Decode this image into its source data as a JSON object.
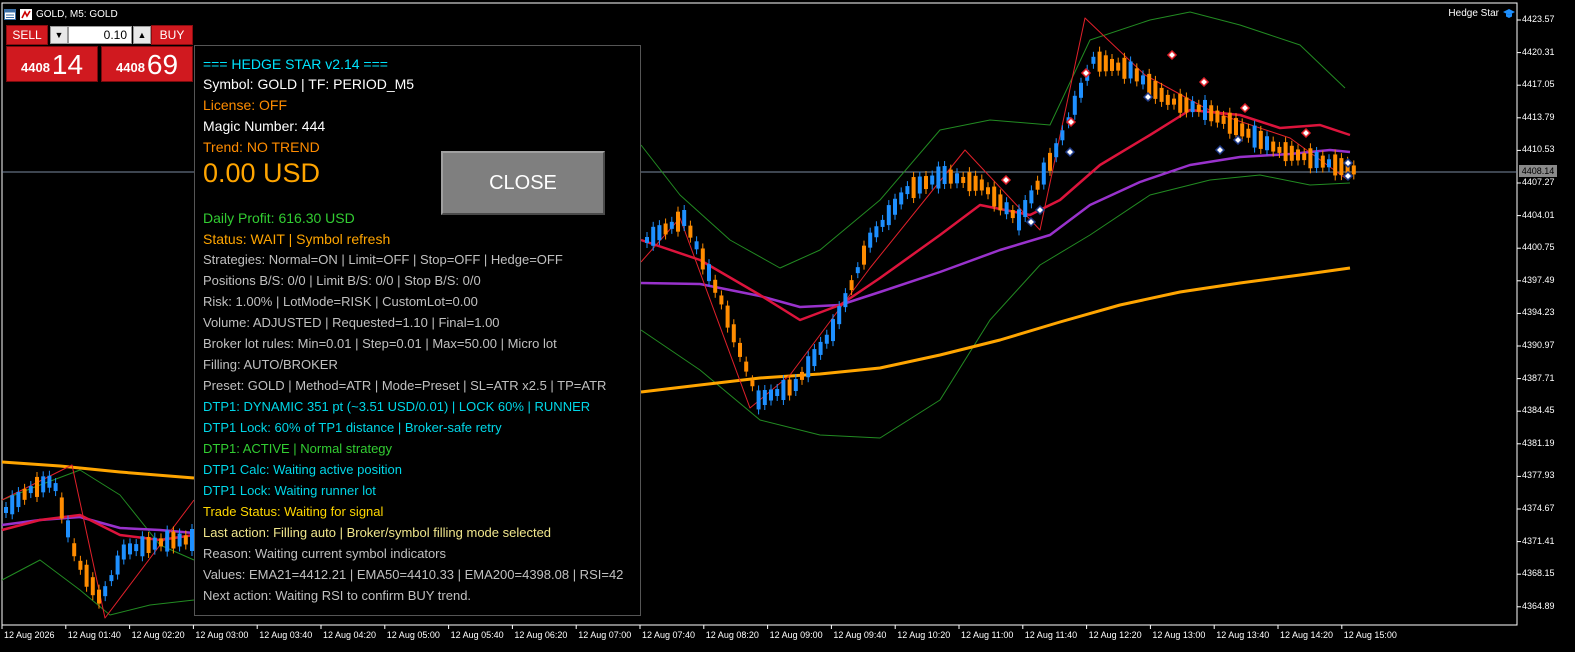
{
  "window": {
    "title": "GOLD, M5:  GOLD",
    "brand": "Hedge Star"
  },
  "trade_panel": {
    "sell_label": "SELL",
    "buy_label": "BUY",
    "lot": "0.10",
    "sell_price_prefix": "4408",
    "sell_price_big": "14",
    "buy_price_prefix": "4408",
    "buy_price_big": "69"
  },
  "info": {
    "lines": [
      {
        "text": "=== HEDGE STAR v2.14 ===",
        "color": "#00e5ff"
      },
      {
        "text": "Symbol: GOLD | TF: PERIOD_M5",
        "color": "#ffffff"
      },
      {
        "text": "License: OFF",
        "color": "#ff8c00"
      },
      {
        "text": "Magic Number: 444",
        "color": "#ffffff"
      },
      {
        "text": "Trend: NO TREND",
        "color": "#ff8c00"
      },
      {
        "text": "0.00 USD",
        "color": "#ffa500"
      },
      {
        "text": "Daily Profit: 616.30 USD",
        "color": "#32cd32"
      },
      {
        "text": "Status: WAIT | Symbol refresh",
        "color": "#ffa500"
      },
      {
        "text": "Strategies: Normal=ON | Limit=OFF | Stop=OFF | Hedge=OFF",
        "color": "#c0c0c0"
      },
      {
        "text": "Positions B/S: 0/0 | Limit B/S: 0/0 | Stop B/S: 0/0",
        "color": "#c0c0c0"
      },
      {
        "text": "Risk: 1.00% | LotMode=RISK | CustomLot=0.00",
        "color": "#c0c0c0"
      },
      {
        "text": "Volume: ADJUSTED | Requested=1.10 | Final=1.00",
        "color": "#c0c0c0"
      },
      {
        "text": "Broker lot rules: Min=0.01 | Step=0.01 | Max=50.00 | Micro lot",
        "color": "#c0c0c0"
      },
      {
        "text": "Filling: AUTO/BROKER",
        "color": "#c0c0c0"
      },
      {
        "text": "Preset: GOLD | Method=ATR | Mode=Preset | SL=ATR x2.5 | TP=ATR",
        "color": "#c0c0c0"
      },
      {
        "text": "DTP1: DYNAMIC 351 pt (~3.51 USD/0.01) | LOCK 60% | RUNNER",
        "color": "#00d7e8"
      },
      {
        "text": "DTP1 Lock: 60% of TP1 distance | Broker-safe retry",
        "color": "#00d7e8"
      },
      {
        "text": "DTP1: ACTIVE | Normal strategy",
        "color": "#32cd32"
      },
      {
        "text": "DTP1 Calc: Waiting active position",
        "color": "#00d7e8"
      },
      {
        "text": "DTP1 Lock: Waiting runner lot",
        "color": "#00d7e8"
      },
      {
        "text": "Trade Status: Waiting for signal",
        "color": "#ffd700"
      },
      {
        "text": "Last action: Filling auto | Broker/symbol filling mode selected",
        "color": "#f0e68c"
      },
      {
        "text": "Reason: Waiting current symbol indicators",
        "color": "#c0c0c0"
      },
      {
        "text": "Values: EMA21=4412.21 | EMA50=4410.33 | EMA200=4398.08 | RSI=42",
        "color": "#c0c0c0"
      },
      {
        "text": "Next action: Waiting RSI to confirm BUY trend.",
        "color": "#c0c0c0"
      }
    ],
    "close_label": "CLOSE"
  },
  "price_axis": {
    "ticks": [
      "4423.57",
      "4420.31",
      "4417.05",
      "4413.79",
      "4410.53",
      "4407.27",
      "4404.01",
      "4400.75",
      "4397.49",
      "4394.23",
      "4390.97",
      "4387.71",
      "4384.45",
      "4381.19",
      "4377.93",
      "4374.67",
      "4371.41",
      "4368.15",
      "4364.89"
    ],
    "current": "4408.14"
  },
  "time_axis": {
    "ticks": [
      "12 Aug 2026",
      "12 Aug 01:40",
      "12 Aug 02:20",
      "12 Aug 03:00",
      "12 Aug 03:40",
      "12 Aug 04:20",
      "12 Aug 05:00",
      "12 Aug 05:40",
      "12 Aug 06:20",
      "12 Aug 07:00",
      "12 Aug 07:40",
      "12 Aug 08:20",
      "12 Aug 09:00",
      "12 Aug 09:40",
      "12 Aug 10:20",
      "12 Aug 11:00",
      "12 Aug 11:40",
      "12 Aug 12:20",
      "12 Aug 13:00",
      "12 Aug 13:40",
      "12 Aug 14:20",
      "12 Aug 15:00"
    ]
  },
  "colors": {
    "bull": "#1e90ff",
    "bear": "#ff8c00",
    "ema21": "#dc143c",
    "ema50": "#9932cc",
    "ema200": "#ffa500",
    "bands": "#228b22"
  }
}
